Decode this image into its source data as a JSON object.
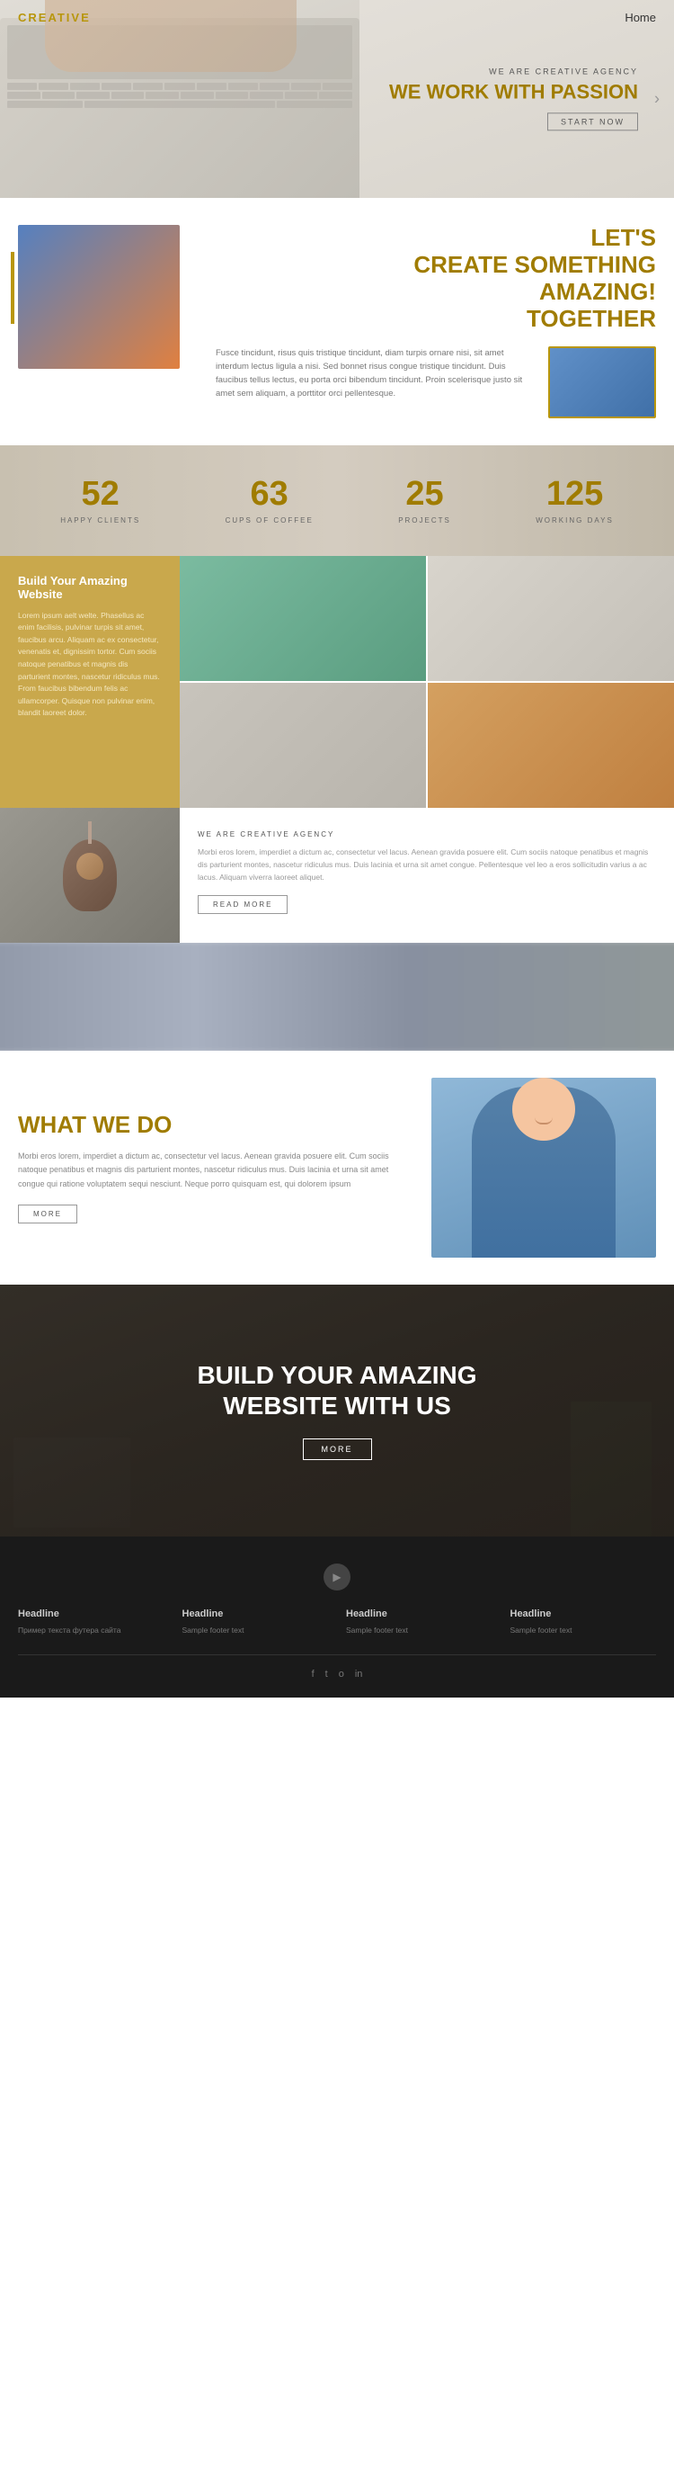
{
  "header": {
    "logo": "CREATIVE",
    "nav": "Home"
  },
  "hero": {
    "subtitle": "WE ARE CREATIVE AGENCY",
    "title": "WE WORK WITH PASSION",
    "button": "START NOW"
  },
  "lets_create": {
    "title_line1": "LET'S",
    "title_line2": "CREATE SOMETHING",
    "title_line3": "AMAZING!",
    "title_line4": "TOGETHER",
    "body_text": "Fusce tincidunt, risus quis tristique tincidunt, diam turpis ornare nisi, sit amet interdum lectus ligula a nisi. Sed bonnet risus congue tristique tincidunt. Duis faucibus tellus lectus, eu porta orci bibendum tincidunt. Proin scelerisque justo sit amet sem aliquam, a porttitor orci pellentesque."
  },
  "stats": [
    {
      "number": "52",
      "label": "HAPPY CLIENTS"
    },
    {
      "number": "63",
      "label": "CUPS OF COFFEE"
    },
    {
      "number": "25",
      "label": "PROJECTS"
    },
    {
      "number": "125",
      "label": "WORKING DAYS"
    }
  ],
  "build_website": {
    "title": "Build Your Amazing Website",
    "text": "Lorem ipsum aelt welte. Phasellus ac enim facilisis, pulvinar turpis sit amet, faucibus arcu. Aliquam ac ex consectetur, venenatis et, dignissim tortor. Cum sociis natoque penatibus et magnis dis parturient montes, nascetur ridiculus mus. From faucibus bibendum felis ac ullamcorper. Quisque non pulvinar enim, blandit laoreet dolor."
  },
  "creative_agency": {
    "subtitle": "WE ARE CREATIVE AGENCY",
    "text": "Morbi eros lorem, imperdiet a dictum ac, consectetur vel lacus. Aenean gravida posuere elit. Cum sociis natoque penatibus et magnis dis parturient montes, nascetur ridiculus mus. Duis lacinia et urna sit amet congue. Pellentesque vel leo a eros sollicitudin varius a ac lacus. Aliquam viverra laoreet aliquet.",
    "read_more": "READ MORE"
  },
  "what_we_do": {
    "title": "WHAT WE DO",
    "text": "Morbi eros lorem, imperdiet a dictum ac, consectetur vel lacus. Aenean gravida posuere elit. Cum sociis natoque penatibus et magnis dis parturient montes, nascetur ridiculus mus. Duis lacinia et urna sit amet congue qui ratione voluptatem sequi nesciunt. Neque porro quisquam est, qui dolorem ipsum",
    "button": "MORE"
  },
  "build_amazing": {
    "title_line1": "BUILD YOUR AMAZING",
    "title_line2": "WEBSITE WITH US",
    "button": "MORE"
  },
  "footer": {
    "columns": [
      {
        "title": "Headline",
        "text": "Пример текста футера сайта"
      },
      {
        "title": "Headline",
        "text": "Sample footer text"
      },
      {
        "title": "Headline",
        "text": "Sample footer text"
      },
      {
        "title": "Headline",
        "text": "Sample footer text"
      }
    ],
    "social_icons": [
      "f",
      "t",
      "o",
      "in"
    ]
  }
}
